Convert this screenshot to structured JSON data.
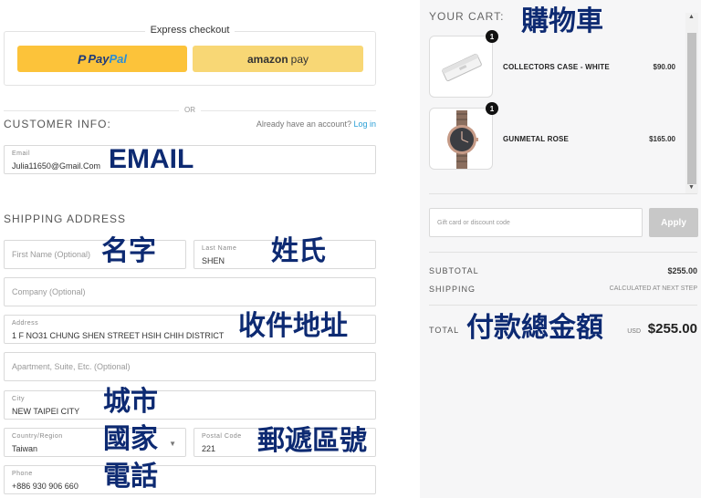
{
  "express": {
    "title": "Express checkout",
    "paypal_p": "P",
    "paypal_pay": "Pay",
    "paypal_pal": "Pal",
    "amazon_brand": "amazon",
    "amazon_pay": "pay"
  },
  "divider_or": "OR",
  "customer": {
    "title": "CUSTOMER INFO:",
    "account_hint": "Already have an account?",
    "login_label": "Log in",
    "email_label": "Email",
    "email_value": "Julia11650@Gmail.Com"
  },
  "shipping": {
    "title": "SHIPPING ADDRESS",
    "first_name_placeholder": "First Name (Optional)",
    "last_name_label": "Last Name",
    "last_name_value": "SHEN",
    "company_placeholder": "Company (Optional)",
    "address_label": "Address",
    "address_value": "1 F NO31 CHUNG SHEN STREET HSIH CHIH DISTRICT",
    "apartment_placeholder": "Apartment, Suite, Etc. (Optional)",
    "city_label": "City",
    "city_value": "NEW TAIPEI CITY",
    "country_label": "Country/Region",
    "country_value": "Taiwan",
    "postal_label": "Postal Code",
    "postal_value": "221",
    "phone_label": "Phone",
    "phone_value": "+886 930 906 660"
  },
  "annotations": {
    "email": "EMAIL",
    "first_name": "名字",
    "last_name": "姓氏",
    "address": "收件地址",
    "city": "城市",
    "country": "國家",
    "postal": "郵遞區號",
    "phone": "電話",
    "cart": "購物車",
    "total": "付款總金額"
  },
  "cart": {
    "title": "YOUR CART:",
    "items": [
      {
        "name": "COLLECTORS CASE - WHITE",
        "price": "$90.00",
        "qty": "1"
      },
      {
        "name": "GUNMETAL ROSE",
        "price": "$165.00",
        "qty": "1"
      }
    ]
  },
  "discount": {
    "placeholder": "Gift card or discount code",
    "apply_label": "Apply"
  },
  "summary": {
    "subtotal_label": "SUBTOTAL",
    "subtotal_value": "$255.00",
    "shipping_label": "SHIPPING",
    "shipping_value": "CALCULATED AT NEXT STEP",
    "total_label": "TOTAL",
    "total_currency": "USD",
    "total_value": "$255.00"
  },
  "colors": {
    "paypal": "#fcc33a",
    "amazon": "#f8d775",
    "annotation": "#0d2a72",
    "link": "#2a9fd6"
  }
}
